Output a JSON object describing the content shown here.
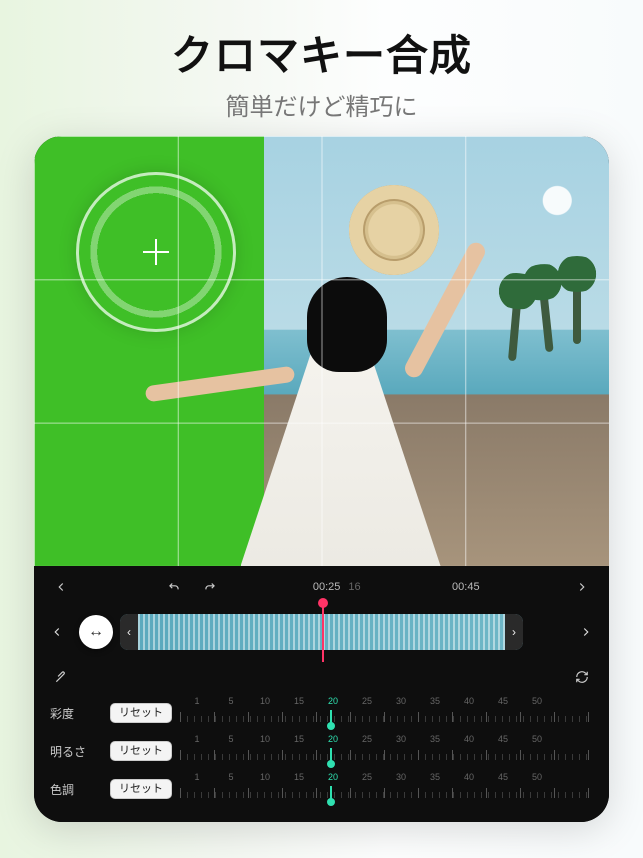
{
  "header": {
    "title": "クロマキー合成",
    "subtitle": "簡単だけど精巧に"
  },
  "time": {
    "current": "00:25",
    "frame": "16",
    "total": "00:45"
  },
  "drag_glyph": "↔",
  "params": [
    {
      "label": "彩度",
      "reset": "リセット",
      "value": 20,
      "ticks": [
        1,
        5,
        10,
        15,
        20,
        25,
        30,
        35,
        40,
        45,
        50
      ]
    },
    {
      "label": "明るさ",
      "reset": "リセット",
      "value": 20,
      "ticks": [
        1,
        5,
        10,
        15,
        20,
        25,
        30,
        35,
        40,
        45,
        50
      ]
    },
    {
      "label": "色調",
      "reset": "リセット",
      "value": 20,
      "ticks": [
        1,
        5,
        10,
        15,
        20,
        25,
        30,
        35,
        40,
        45,
        50
      ]
    }
  ]
}
